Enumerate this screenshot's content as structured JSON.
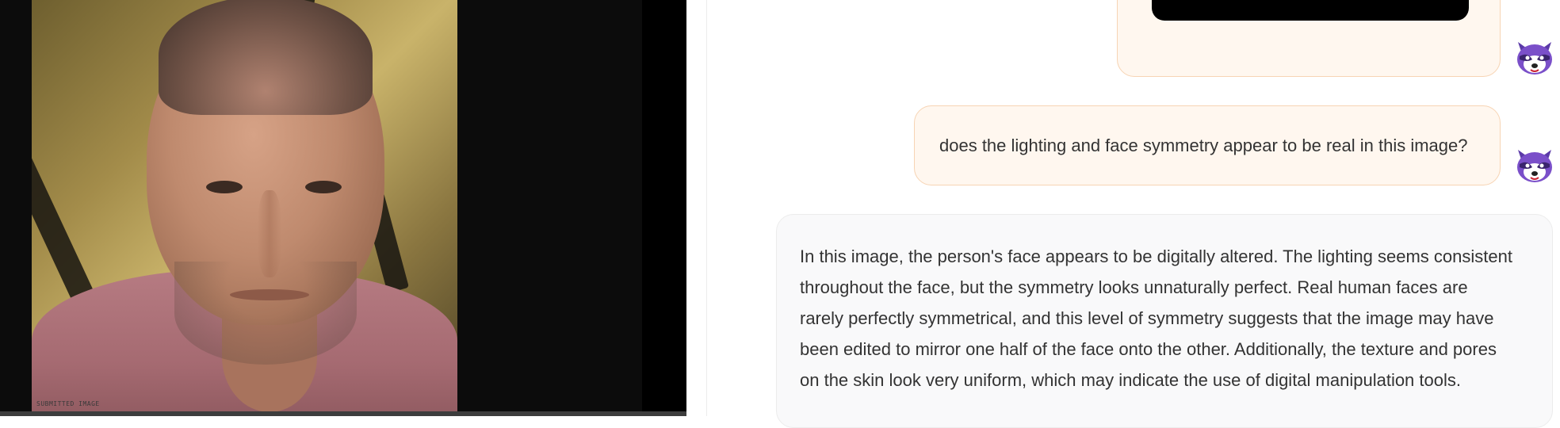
{
  "viewer": {
    "caption": "SUBMITTED IMAGE"
  },
  "chat": {
    "messages": [
      {
        "role": "user",
        "text": "does the lighting and face symmetry appear to be real in this image?"
      },
      {
        "role": "assistant",
        "lines": [
          "In this image, the person's face appears to be digitally altered. The lighting seems consistent",
          "throughout the face, but the symmetry looks unnaturally perfect. Real human faces are",
          "rarely perfectly symmetrical, and this level of symmetry suggests that the image may have",
          "been edited to mirror one half of the face onto the other. Additionally, the texture and pores",
          "on the skin look very uniform, which may indicate the use of digital manipulation tools."
        ]
      }
    ]
  },
  "colors": {
    "user_bubble_bg": "#fff7ef",
    "user_bubble_border": "#f7d4b4",
    "bot_bubble_bg": "#f9f9fa",
    "avatar_purple": "#7a4fc9"
  }
}
